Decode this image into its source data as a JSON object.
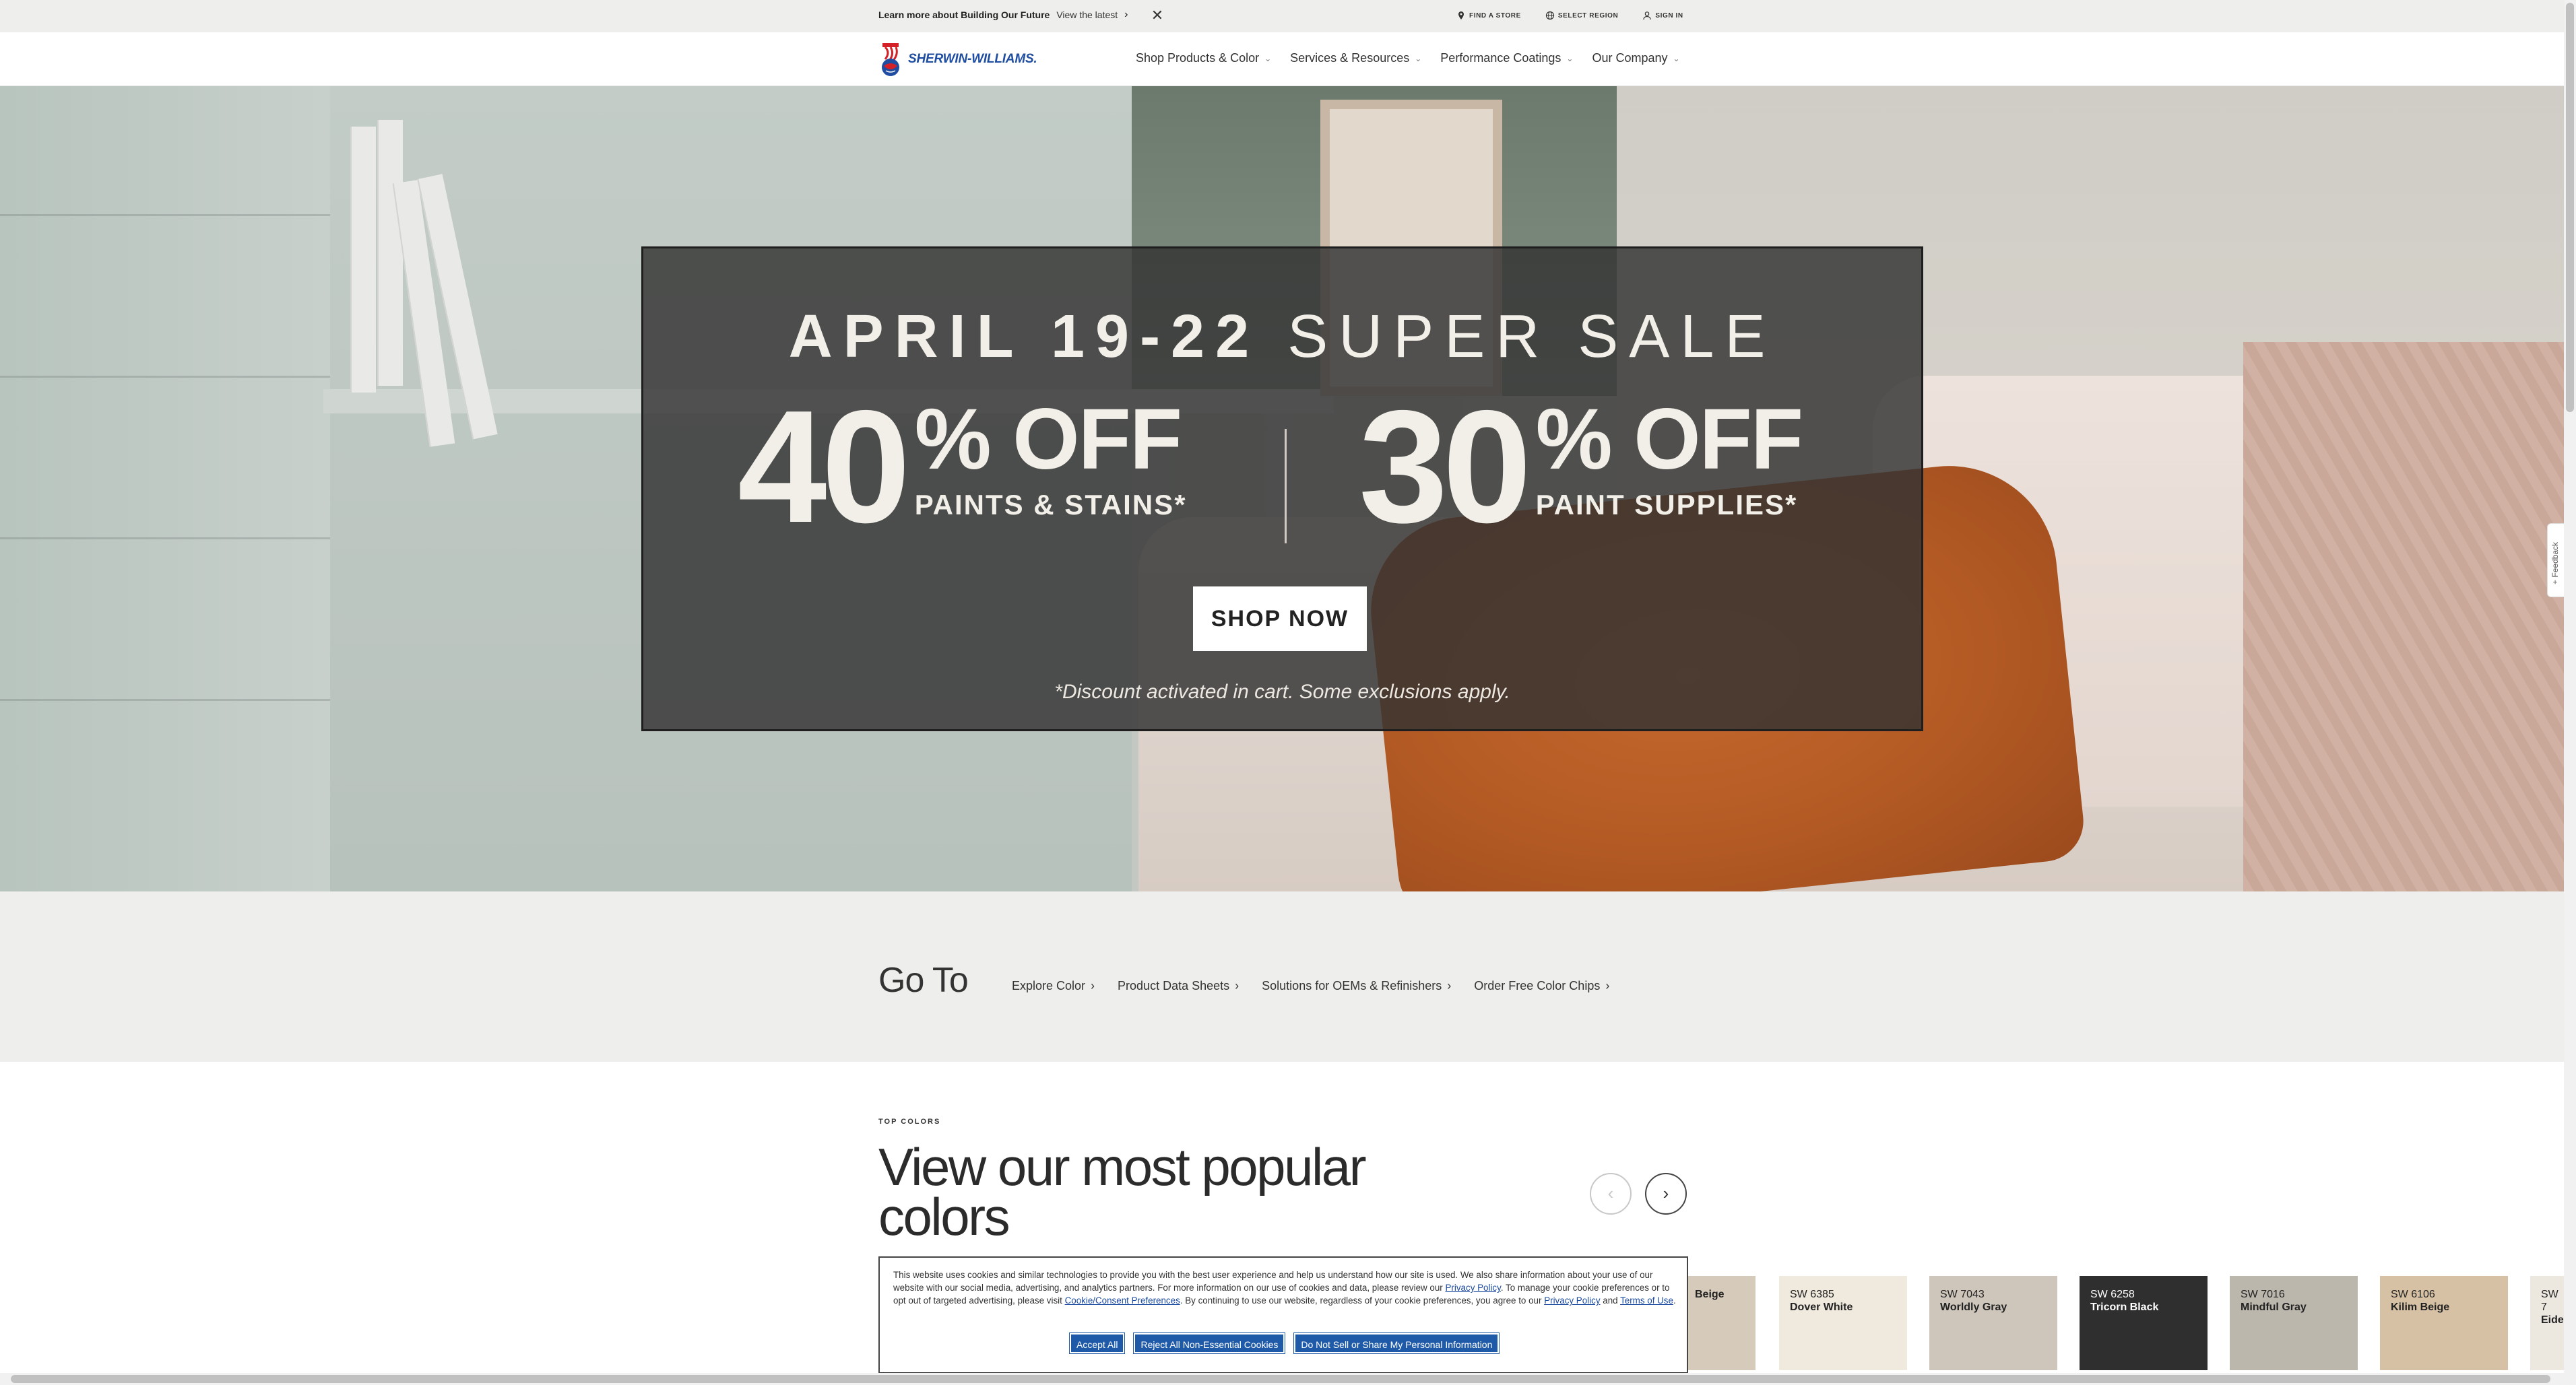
{
  "announcement": {
    "bold": "Learn more about Building Our Future",
    "link": "View the latest",
    "chevron": "›",
    "close": "✕"
  },
  "utility": {
    "find_store": "FIND A STORE",
    "select_region": "SELECT REGION",
    "sign_in": "SIGN IN"
  },
  "brand": {
    "name": "SHERWIN-WILLIAMS."
  },
  "nav": {
    "items": [
      {
        "label": "Shop Products & Color"
      },
      {
        "label": "Services & Resources"
      },
      {
        "label": "Performance Coatings"
      },
      {
        "label": "Our Company"
      }
    ],
    "caret": "⌄"
  },
  "hero": {
    "headline_bold": "APRIL 19-22",
    "headline_light": "SUPER SALE",
    "offer1_num": "40",
    "offer1_pct": "% OFF",
    "offer1_what": "PAINTS & STAINS*",
    "offer2_num": "30",
    "offer2_pct": "% OFF",
    "offer2_what": "PAINT SUPPLIES*",
    "cta": "SHOP NOW",
    "disclaimer": "*Discount activated in cart. Some exclusions apply."
  },
  "feedback": {
    "label": "+ Feedback"
  },
  "goto": {
    "title": "Go To",
    "links": [
      {
        "label": "Explore Color"
      },
      {
        "label": "Product Data Sheets"
      },
      {
        "label": "Solutions for OEMs & Refinishers"
      },
      {
        "label": "Order Free Color Chips"
      }
    ],
    "chev": "›"
  },
  "top_colors": {
    "eyebrow": "TOP COLORS",
    "title": "View our most popular colors",
    "prev": "‹",
    "next": "›",
    "swatches": [
      {
        "code": "",
        "name": "Beige",
        "color": "#d6cbbb",
        "text": "#222222"
      },
      {
        "code": "SW 6385",
        "name": "Dover White",
        "color": "#f0e9dd",
        "text": "#222222"
      },
      {
        "code": "SW 7043",
        "name": "Worldly Gray",
        "color": "#cec6bb",
        "text": "#222222"
      },
      {
        "code": "SW 6258",
        "name": "Tricorn Black",
        "color": "#2f2f30",
        "text": "#ffffff"
      },
      {
        "code": "SW 7016",
        "name": "Mindful Gray",
        "color": "#bcb7ad",
        "text": "#222222"
      },
      {
        "code": "SW 6106",
        "name": "Kilim Beige",
        "color": "#d6c1a4",
        "text": "#222222"
      },
      {
        "code": "SW 7",
        "name": "Eide",
        "color": "#ece8e0",
        "text": "#222222"
      }
    ]
  },
  "cookie": {
    "text1": "This website uses cookies and similar technologies to provide you with the best user experience and help us understand how our site is used. We also share information about your use of our website with our social media, advertising, and analytics partners. For more information on our use of cookies and data, please review our ",
    "link_privacy": "Privacy Policy",
    "text2": ". To manage your cookie preferences or to opt out of targeted advertising, please visit ",
    "link_consent": "Cookie/Consent Preferences",
    "text3": ". By continuing to use our website, regardless of your cookie preferences, you agree to our ",
    "link_privacy2": "Privacy Policy",
    "text4": " and ",
    "link_terms": "Terms of Use",
    "text5": ".",
    "accept": "Accept All",
    "reject": "Reject All Non-Essential Cookies",
    "donotsell": "Do Not Sell or Share My Personal Information"
  }
}
